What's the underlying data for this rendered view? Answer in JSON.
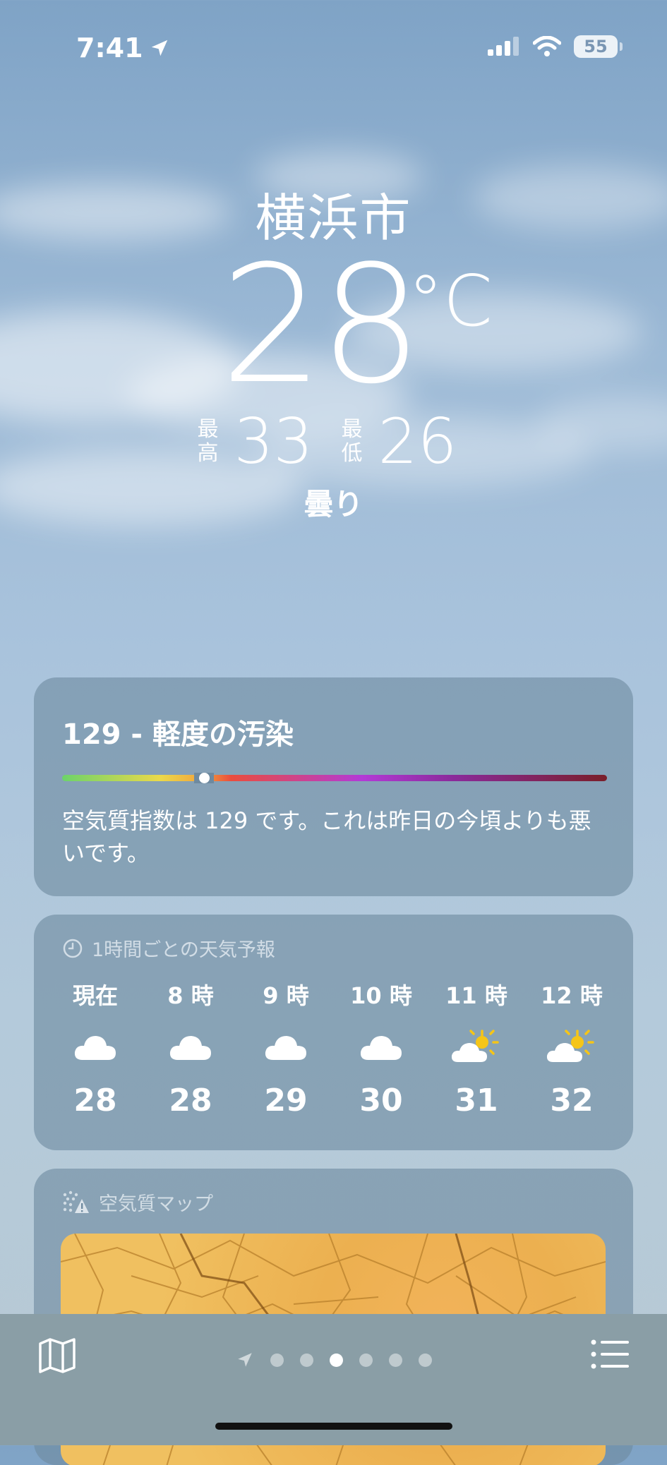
{
  "status_bar": {
    "time": "7:41",
    "battery": "55"
  },
  "location": {
    "city": "横浜市"
  },
  "current": {
    "temp": "28",
    "unit": "°C",
    "high_label_1": "最",
    "high_label_2": "高",
    "high": "33",
    "low_label_1": "最",
    "low_label_2": "低",
    "low": "26",
    "condition": "曇り"
  },
  "air_quality": {
    "title": "129 - 軽度の汚染",
    "index": 129,
    "level_fraction": 0.26,
    "description": "空気質指数は 129 です。これは昨日の今頃よりも悪いです。"
  },
  "hourly": {
    "header": "1時間ごとの天気予報",
    "items": [
      {
        "hour": "現在",
        "icon": "cloud-icon",
        "temp": "28"
      },
      {
        "hour": "8 時",
        "icon": "cloud-icon",
        "temp": "28"
      },
      {
        "hour": "9 時",
        "icon": "cloud-icon",
        "temp": "29"
      },
      {
        "hour": "10 時",
        "icon": "cloud-icon",
        "temp": "30"
      },
      {
        "hour": "11 時",
        "icon": "partly-sunny-icon",
        "temp": "31"
      },
      {
        "hour": "12 時",
        "icon": "partly-sunny-icon",
        "temp": "32"
      }
    ]
  },
  "air_map": {
    "header": "空気質マップ"
  },
  "pager": {
    "total_pages": 6,
    "active_index": 2
  },
  "colors": {
    "sun": "#f5c518",
    "map_fill": "#f0b456",
    "map_lines": "#b8802c"
  }
}
